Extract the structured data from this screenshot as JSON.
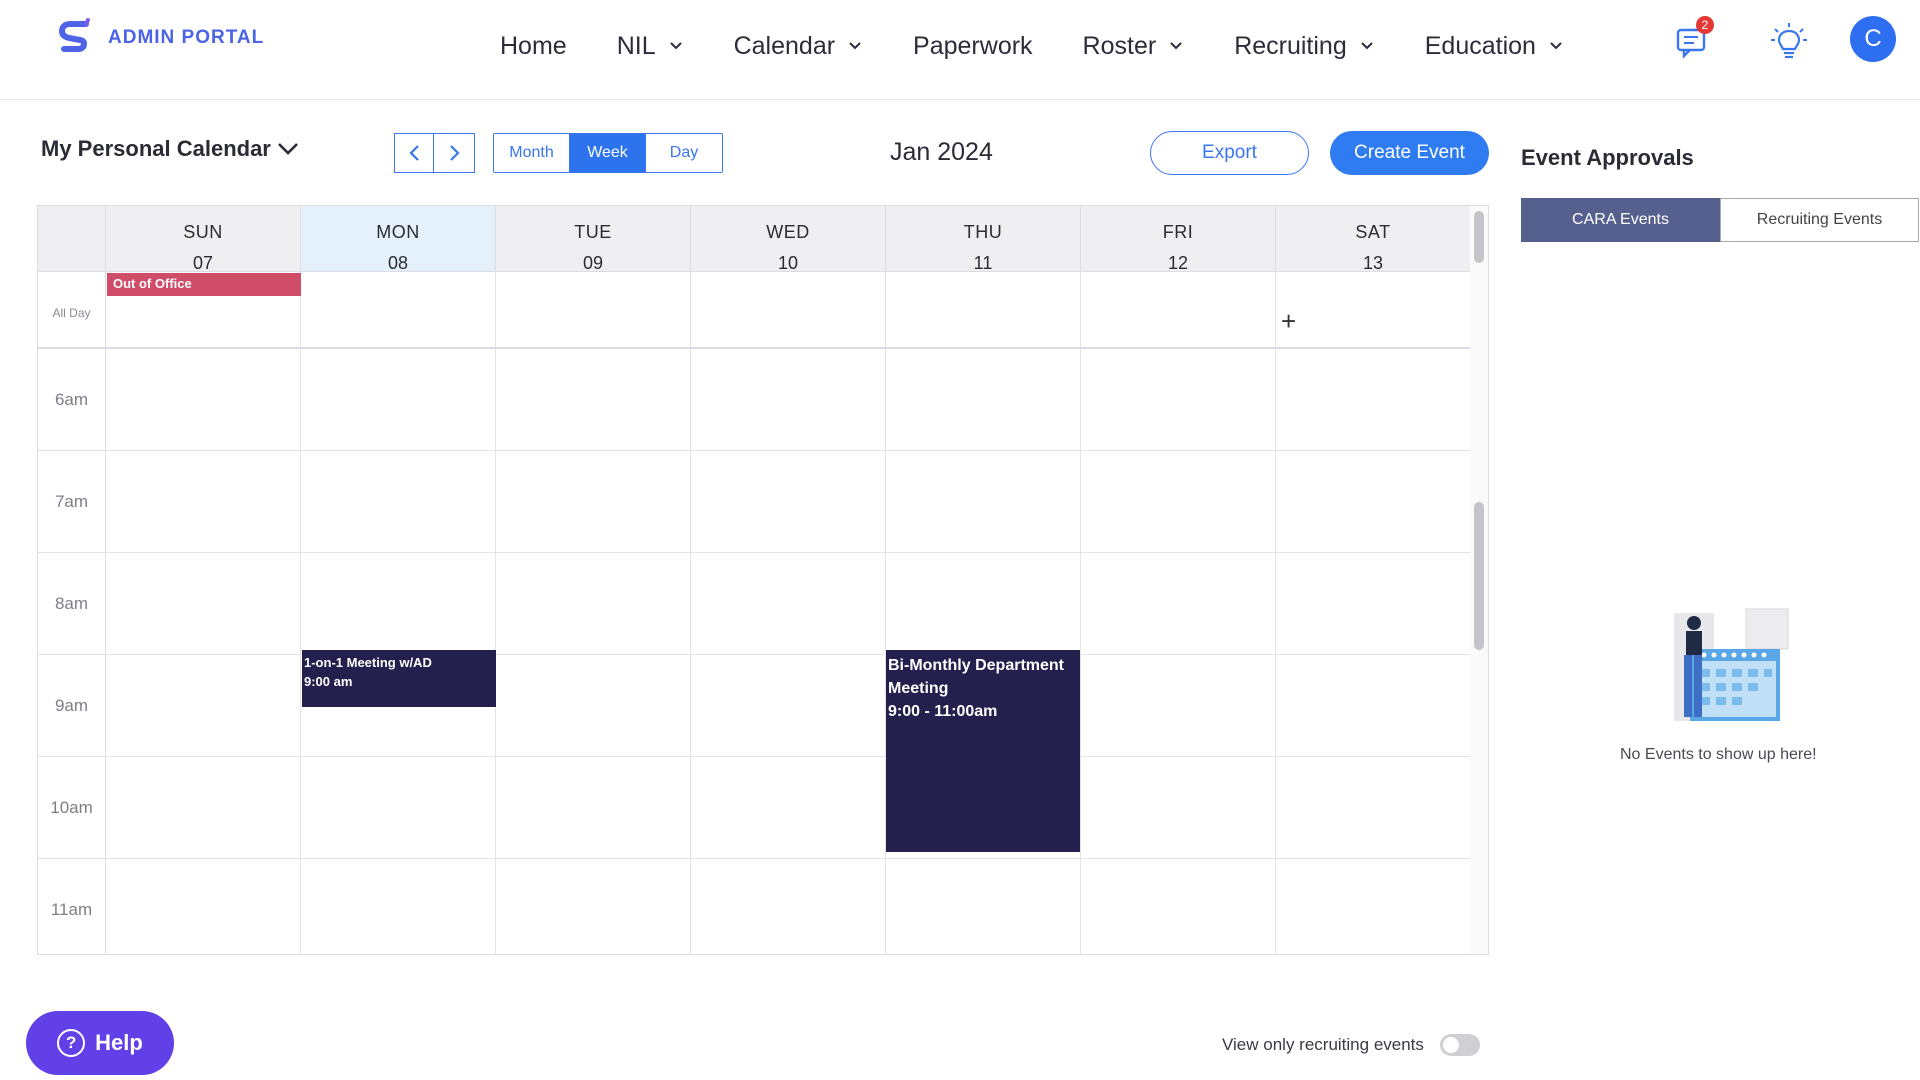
{
  "brand": {
    "name": "ADMIN PORTAL"
  },
  "nav": {
    "items": [
      {
        "label": "Home",
        "dropdown": false
      },
      {
        "label": "NIL",
        "dropdown": true
      },
      {
        "label": "Calendar",
        "dropdown": true
      },
      {
        "label": "Paperwork",
        "dropdown": false
      },
      {
        "label": "Roster",
        "dropdown": true
      },
      {
        "label": "Recruiting",
        "dropdown": true
      },
      {
        "label": "Education",
        "dropdown": true
      }
    ],
    "messages_badge": "2",
    "avatar_initial": "C"
  },
  "toolbar": {
    "calendar_select": "My Personal Calendar",
    "views": [
      "Month",
      "Week",
      "Day"
    ],
    "active_view": "Week",
    "month_title": "Jan 2024",
    "export_label": "Export",
    "create_label": "Create Event"
  },
  "calendar": {
    "days": [
      {
        "name": "SUN",
        "num": "07"
      },
      {
        "name": "MON",
        "num": "08"
      },
      {
        "name": "TUE",
        "num": "09"
      },
      {
        "name": "WED",
        "num": "10"
      },
      {
        "name": "THU",
        "num": "11"
      },
      {
        "name": "FRI",
        "num": "12"
      },
      {
        "name": "SAT",
        "num": "13"
      }
    ],
    "today": "MON",
    "all_day_label": "All Day",
    "times": [
      "6am",
      "7am",
      "8am",
      "9am",
      "10am",
      "11am"
    ],
    "all_day_event": "Out of Office",
    "events": [
      {
        "title": "1-on-1 Meeting w/AD",
        "time": "9:00 am",
        "day": "MON"
      },
      {
        "title": "Bi-Monthly Department Meeting",
        "time": "9:00 - 11:00am",
        "day": "THU"
      }
    ]
  },
  "approvals": {
    "title": "Event Approvals",
    "tabs": [
      "CARA Events",
      "Recruiting Events"
    ],
    "active_tab": "CARA Events",
    "empty_text": "No Events to show up here!"
  },
  "footer": {
    "help_label": "Help",
    "toggle_label": "View only recruiting events",
    "toggle_on": false
  },
  "colors": {
    "accent": "#2f7bf2",
    "event": "#24204e",
    "out_of_office": "#d04d6a",
    "help": "#6240e8",
    "approvals_active": "#56608f"
  }
}
